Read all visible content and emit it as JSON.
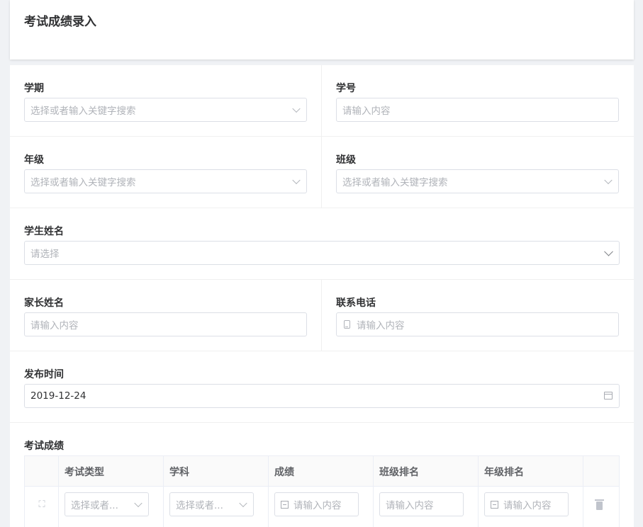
{
  "page": {
    "title": "考试成绩录入"
  },
  "form": {
    "term": {
      "label": "学期",
      "placeholder": "选择或者输入关键字搜索"
    },
    "student_no": {
      "label": "学号",
      "placeholder": "请输入内容"
    },
    "grade": {
      "label": "年级",
      "placeholder": "选择或者输入关键字搜索"
    },
    "class": {
      "label": "班级",
      "placeholder": "选择或者输入关键字搜索"
    },
    "student_name": {
      "label": "学生姓名",
      "placeholder": "请选择"
    },
    "parent_name": {
      "label": "家长姓名",
      "placeholder": "请输入内容"
    },
    "phone": {
      "label": "联系电话",
      "placeholder": "请输入内容"
    },
    "publish_time": {
      "label": "发布时间",
      "value": "2019-12-24"
    },
    "scores": {
      "label": "考试成绩"
    }
  },
  "table": {
    "columns": [
      "考试类型",
      "学科",
      "成绩",
      "班级排名",
      "年级排名"
    ],
    "row": {
      "exam_type_placeholder": "选择或者...",
      "subject_placeholder": "选择或者...",
      "score_placeholder": "请输入内容",
      "class_rank_placeholder": "请输入内容",
      "grade_rank_placeholder": "请输入内容"
    }
  }
}
